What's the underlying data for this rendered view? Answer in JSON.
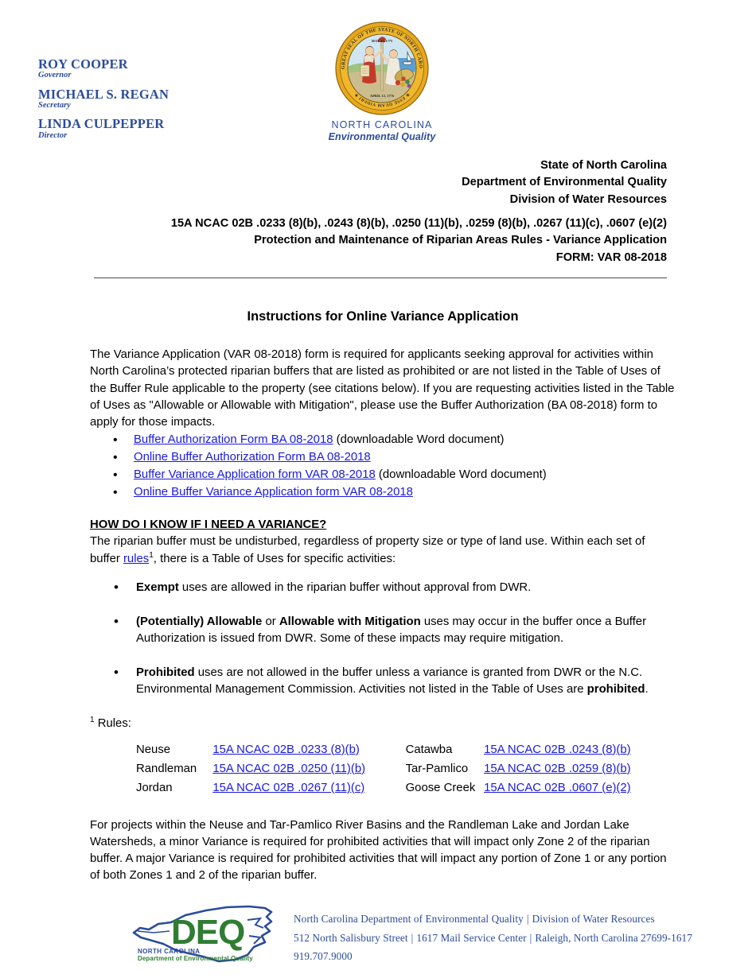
{
  "masthead": {
    "officials": [
      {
        "name": "ROY COOPER",
        "title": "Governor"
      },
      {
        "name": "MICHAEL S. REGAN",
        "title": "Secretary"
      },
      {
        "name": "LINDA CULPEPPER",
        "title": "Director"
      }
    ],
    "seal": {
      "icon": "north-carolina-state-seal-icon",
      "ring_text_top": "THE GREAT SEAL OF THE STATE OF NORTH CAROLINA",
      "date_top": "MAY 20, 1775",
      "date_bottom": "APRIL 12, 1776",
      "motto": "ESSE QUAM VIDERI",
      "caption_line_1": "NORTH CAROLINA",
      "caption_line_2": "Environmental Quality"
    }
  },
  "agency": {
    "line_1": "State of North Carolina",
    "line_2": "Department of Environmental Quality",
    "line_3": "Division of Water Resources"
  },
  "citation": {
    "line_1": "15A NCAC 02B .0233 (8)(b), .0243 (8)(b), .0250 (11)(b), .0259 (8)(b), .0267 (11)(c), .0607 (e)(2)",
    "line_2": "Protection and Maintenance of Riparian Areas Rules - Variance Application",
    "line_3": "FORM:  VAR 08-2018"
  },
  "body": {
    "title": "Instructions for Online Variance Application",
    "intro": "The Variance Application (VAR 08-2018) form is required for applicants seeking approval for activities within North Carolina’s protected riparian buffers that are listed as prohibited or are not listed in the Table of Uses of the Buffer Rule applicable to the property (see citations below).  If you are requesting activities listed in the Table of Uses as \"Allowable or Allowable with Mitigation\", please use the Buffer Authorization (BA 08-2018) form to apply for those impacts.",
    "form_links": [
      {
        "link_text": "Buffer Authorization Form BA 08-2018",
        "suffix": " (downloadable Word document)"
      },
      {
        "link_text": "Online Buffer Authorization Form BA 08-2018",
        "suffix": ""
      },
      {
        "link_text": "Buffer Variance Application form VAR 08-2018",
        "suffix": " (downloadable Word document)"
      },
      {
        "link_text": "Online Buffer Variance Application form VAR 08-2018",
        "suffix": ""
      }
    ],
    "section_heading": "HOW DO I KNOW IF I NEED A VARIANCE?",
    "section_intro_before_link": "The riparian buffer must be undisturbed, regardless of property size or type of land use.  Within each set of buffer ",
    "section_intro_link": "rules",
    "section_intro_superscript": "1",
    "section_intro_after_link": ", there is a Table of Uses for specific activities:",
    "use_categories": [
      {
        "bold_lead": "Exempt",
        "rest": " uses are allowed in the riparian buffer without approval from DWR."
      },
      {
        "bold_lead": "(Potentially) Allowable",
        "mid_plain": " or ",
        "bold_second": "Allowable with Mitigation",
        "rest": " uses may occur in the buffer once a Buffer Authorization is issued from DWR.  Some of these impacts may require mitigation."
      },
      {
        "bold_lead": "Prohibited",
        "rest": " uses are not allowed in the buffer unless a variance is granted from DWR or the N.C. Environmental Management Commission.  Activities not listed in the Table of Uses are ",
        "bold_tail": "prohibited",
        "tail_punct": "."
      }
    ],
    "rules_note_superscript": "1",
    "rules_note_label": " Rules:",
    "rules_rows": [
      {
        "basin_left": "Neuse",
        "rule_left": "15A NCAC 02B .0233 (8)(b)",
        "basin_right": "Catawba",
        "rule_right": "15A NCAC 02B .0243 (8)(b)"
      },
      {
        "basin_left": "Randleman",
        "rule_left": "15A NCAC 02B .0250 (11)(b)",
        "basin_right": "Tar-Pamlico",
        "rule_right": "15A NCAC 02B .0259 (8)(b)"
      },
      {
        "basin_left": "Jordan",
        "rule_left": "15A NCAC 02B .0267 (11)(c)",
        "basin_right": "Goose Creek",
        "rule_right": "15A NCAC 02B .0607 (e)(2)"
      }
    ],
    "closing": "For projects within the Neuse and Tar-Pamlico River Basins and the Randleman Lake and Jordan Lake Watersheds, a minor Variance is required for prohibited activities that will impact only Zone 2 of the riparian buffer.  A major Variance is required for prohibited activities that will impact any portion of Zone 1 or any portion of both Zones 1 and 2 of the riparian buffer."
  },
  "footer": {
    "logo": {
      "icon": "deq-logo-icon",
      "wordmark": "DEQ",
      "sub_line_1": "NORTH CAROLINA",
      "sub_line_2": "Department of Environmental Quality"
    },
    "line_1_part_1": "North Carolina Department of Environmental Quality",
    "line_1_sep": "|",
    "line_1_part_2": "Division of Water Resources",
    "line_2_part_1": "512 North Salisbury Street",
    "line_2_sep_1": "|",
    "line_2_part_2": "1617 Mail Service Center",
    "line_2_sep_2": "|",
    "line_2_part_3": "Raleigh, North Carolina 27699-1617",
    "line_3": "919.707.9000"
  },
  "colors": {
    "heading_blue": "#2b4c9b",
    "link_blue": "#1a1ae0",
    "deq_green": "#2f7d32",
    "deq_blue": "#2b4c9b",
    "seal_gold": "#e8a81c"
  }
}
